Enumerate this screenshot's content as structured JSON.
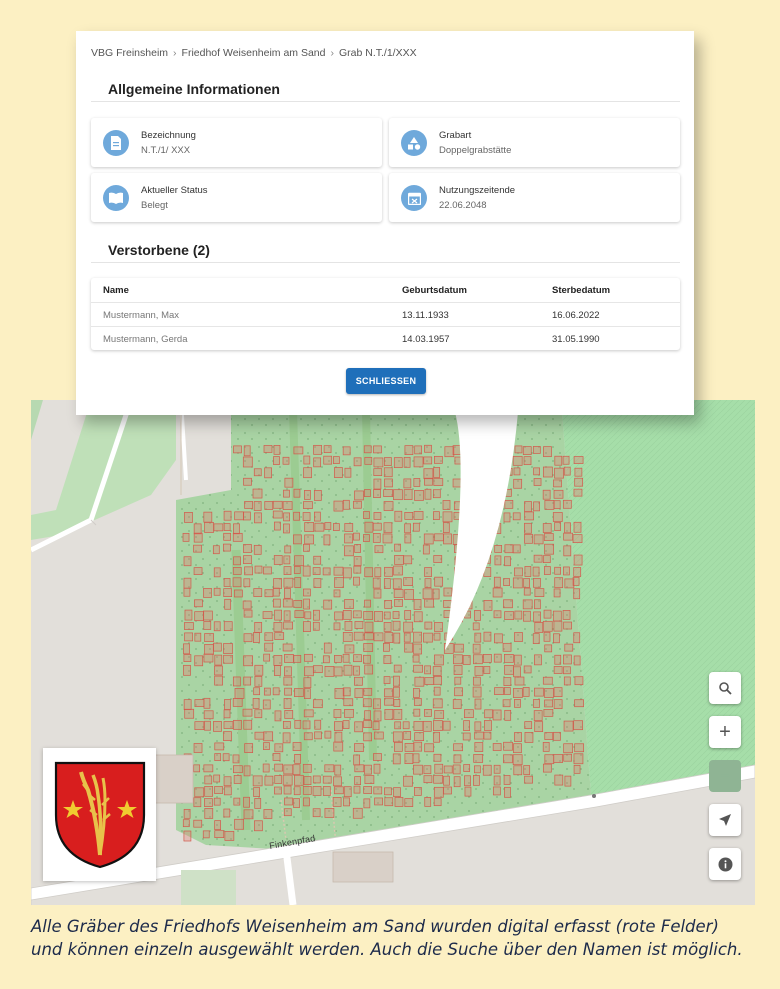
{
  "breadcrumb": [
    "VBG Freinsheim",
    "Friedhof Weisenheim am Sand",
    "Grab N.T./1/XXX"
  ],
  "breadcrumb_separator": "›",
  "sections": {
    "general_title": "Allgemeine Informationen",
    "deceased_title": "Verstorbene (2)"
  },
  "info": {
    "bezeichnung": {
      "label": "Bezeichnung",
      "value": "N.T./1/ XXX",
      "icon": "document-icon"
    },
    "grabart": {
      "label": "Grabart",
      "value": "Doppelgrabstätte",
      "icon": "shapes-icon"
    },
    "status": {
      "label": "Aktueller Status",
      "value": "Belegt",
      "icon": "book-icon"
    },
    "nutzung": {
      "label": "Nutzungszeitende",
      "value": "22.06.2048",
      "icon": "calendar-icon"
    }
  },
  "table": {
    "headers": [
      "Name",
      "Geburtsdatum",
      "Sterbedatum"
    ],
    "rows": [
      [
        "Mustermann, Max",
        "13.11.1933",
        "16.06.2022"
      ],
      [
        "Mustermann, Gerda",
        "14.03.1957",
        "31.05.1990"
      ]
    ]
  },
  "close_button": "SCHLIESSEN",
  "map": {
    "street_label": "Finkenpfad",
    "controls": [
      "search-icon",
      "zoom-in-icon",
      "zoom-out-icon",
      "locate-icon",
      "info-icon"
    ],
    "zoom_in": "+",
    "zoom_out": "−",
    "colors": {
      "grave": "#e07b6f",
      "cemetery": "#a8d5a8",
      "field": "#a8dca8",
      "road": "#ffffff"
    }
  },
  "colors": {
    "accent": "#1f6fba",
    "icon_circle": "#6fa9db",
    "background": "#fcf0c3"
  },
  "caption": {
    "line1": "Alle Gräber des Friedhofs Weisenheim am Sand wurden digital erfasst (rote Felder)",
    "line2": "und können einzeln ausgewählt werden. Auch die Suche über den Namen ist möglich."
  }
}
